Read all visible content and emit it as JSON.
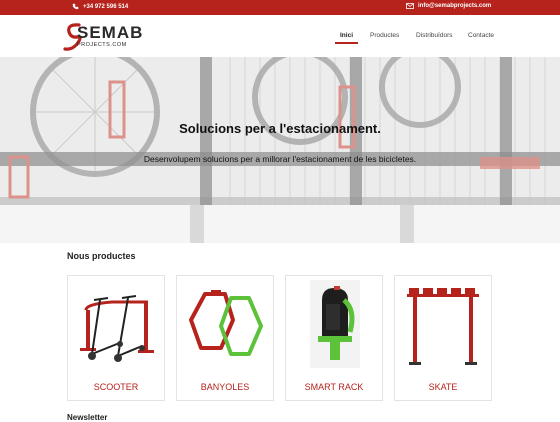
{
  "topbar": {
    "phone": "+34 972 596 514",
    "email": "info@semabprojects.com",
    "phone_icon": "phone-icon",
    "email_icon": "envelope-icon",
    "bg_color": "#b5231c"
  },
  "logo": {
    "brand": "SEMAB",
    "sub": "PROJECTS.COM"
  },
  "nav": {
    "items": [
      "Inici",
      "Productes",
      "Distribuïdors",
      "Contacte"
    ],
    "active": "Inici"
  },
  "hero": {
    "title": "Solucions per a l'estacionament.",
    "subtitle": "Desenvolupem solucions per a millorar l'estacionament de les bicicletes."
  },
  "products": {
    "title": "Nous productes",
    "items": [
      {
        "label": "SCOOTER"
      },
      {
        "label": "BANYOLES"
      },
      {
        "label": "SMART RACK"
      },
      {
        "label": "SKATE"
      }
    ]
  },
  "newsletter": {
    "title": "Newsletter"
  },
  "colors": {
    "accent": "#b5231c",
    "green": "#5cc23a"
  }
}
